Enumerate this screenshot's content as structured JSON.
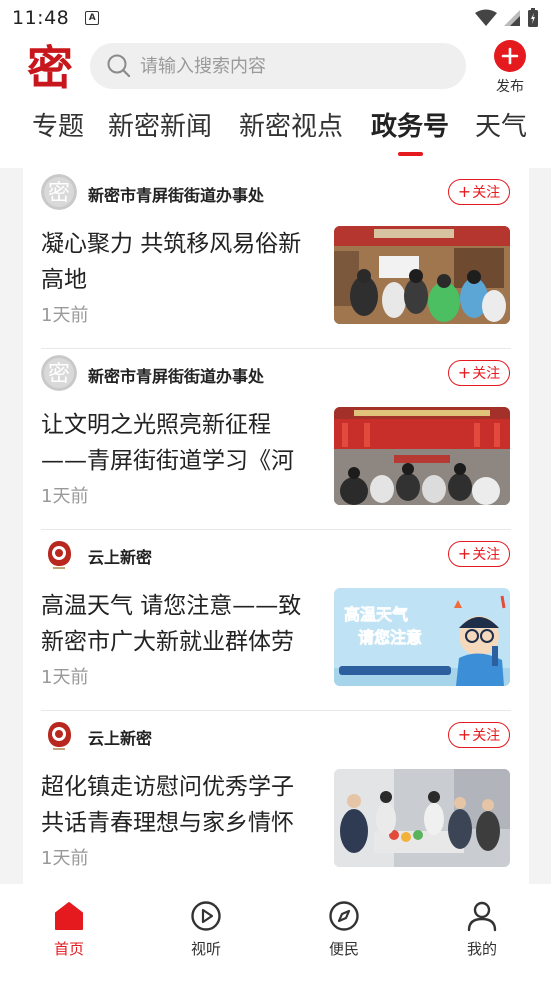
{
  "status_bar": {
    "time": "11:48",
    "notification_icon": "a-notification-icon"
  },
  "header": {
    "logo_text": "密",
    "search_placeholder": "请输入搜索内容",
    "publish_label": "发布"
  },
  "tabs": [
    {
      "label": "专题"
    },
    {
      "label": "新密新闻"
    },
    {
      "label": "新密视点"
    },
    {
      "label": "政务号",
      "active": true
    },
    {
      "label": "天气"
    }
  ],
  "feed": [
    {
      "source": "新密市青屏街街道办事处",
      "follow_label": "关注",
      "title": "凝心聚力 共筑移风易俗新高地",
      "time": "1天前"
    },
    {
      "source": "新密市青屏街街道办事处",
      "follow_label": "关注",
      "title": "让文明之光照亮新征程——青屏街街道学习《河",
      "time": "1天前"
    },
    {
      "source": "云上新密",
      "follow_label": "关注",
      "title": "高温天气 请您注意——致新密市广大新就业群体劳",
      "time": "1天前",
      "thumb_text": [
        "高温天气",
        "请您注意"
      ]
    },
    {
      "source": "云上新密",
      "follow_label": "关注",
      "title": "超化镇走访慰问优秀学子共话青春理想与家乡情怀",
      "time": "1天前"
    }
  ],
  "bottom_nav": [
    {
      "label": "首页",
      "icon": "home-icon",
      "active": true
    },
    {
      "label": "视听",
      "icon": "play-icon"
    },
    {
      "label": "便民",
      "icon": "compass-icon"
    },
    {
      "label": "我的",
      "icon": "user-icon"
    }
  ],
  "colors": {
    "accent": "#e51a1f",
    "muted": "#999999",
    "background": "#f3f3f3"
  }
}
